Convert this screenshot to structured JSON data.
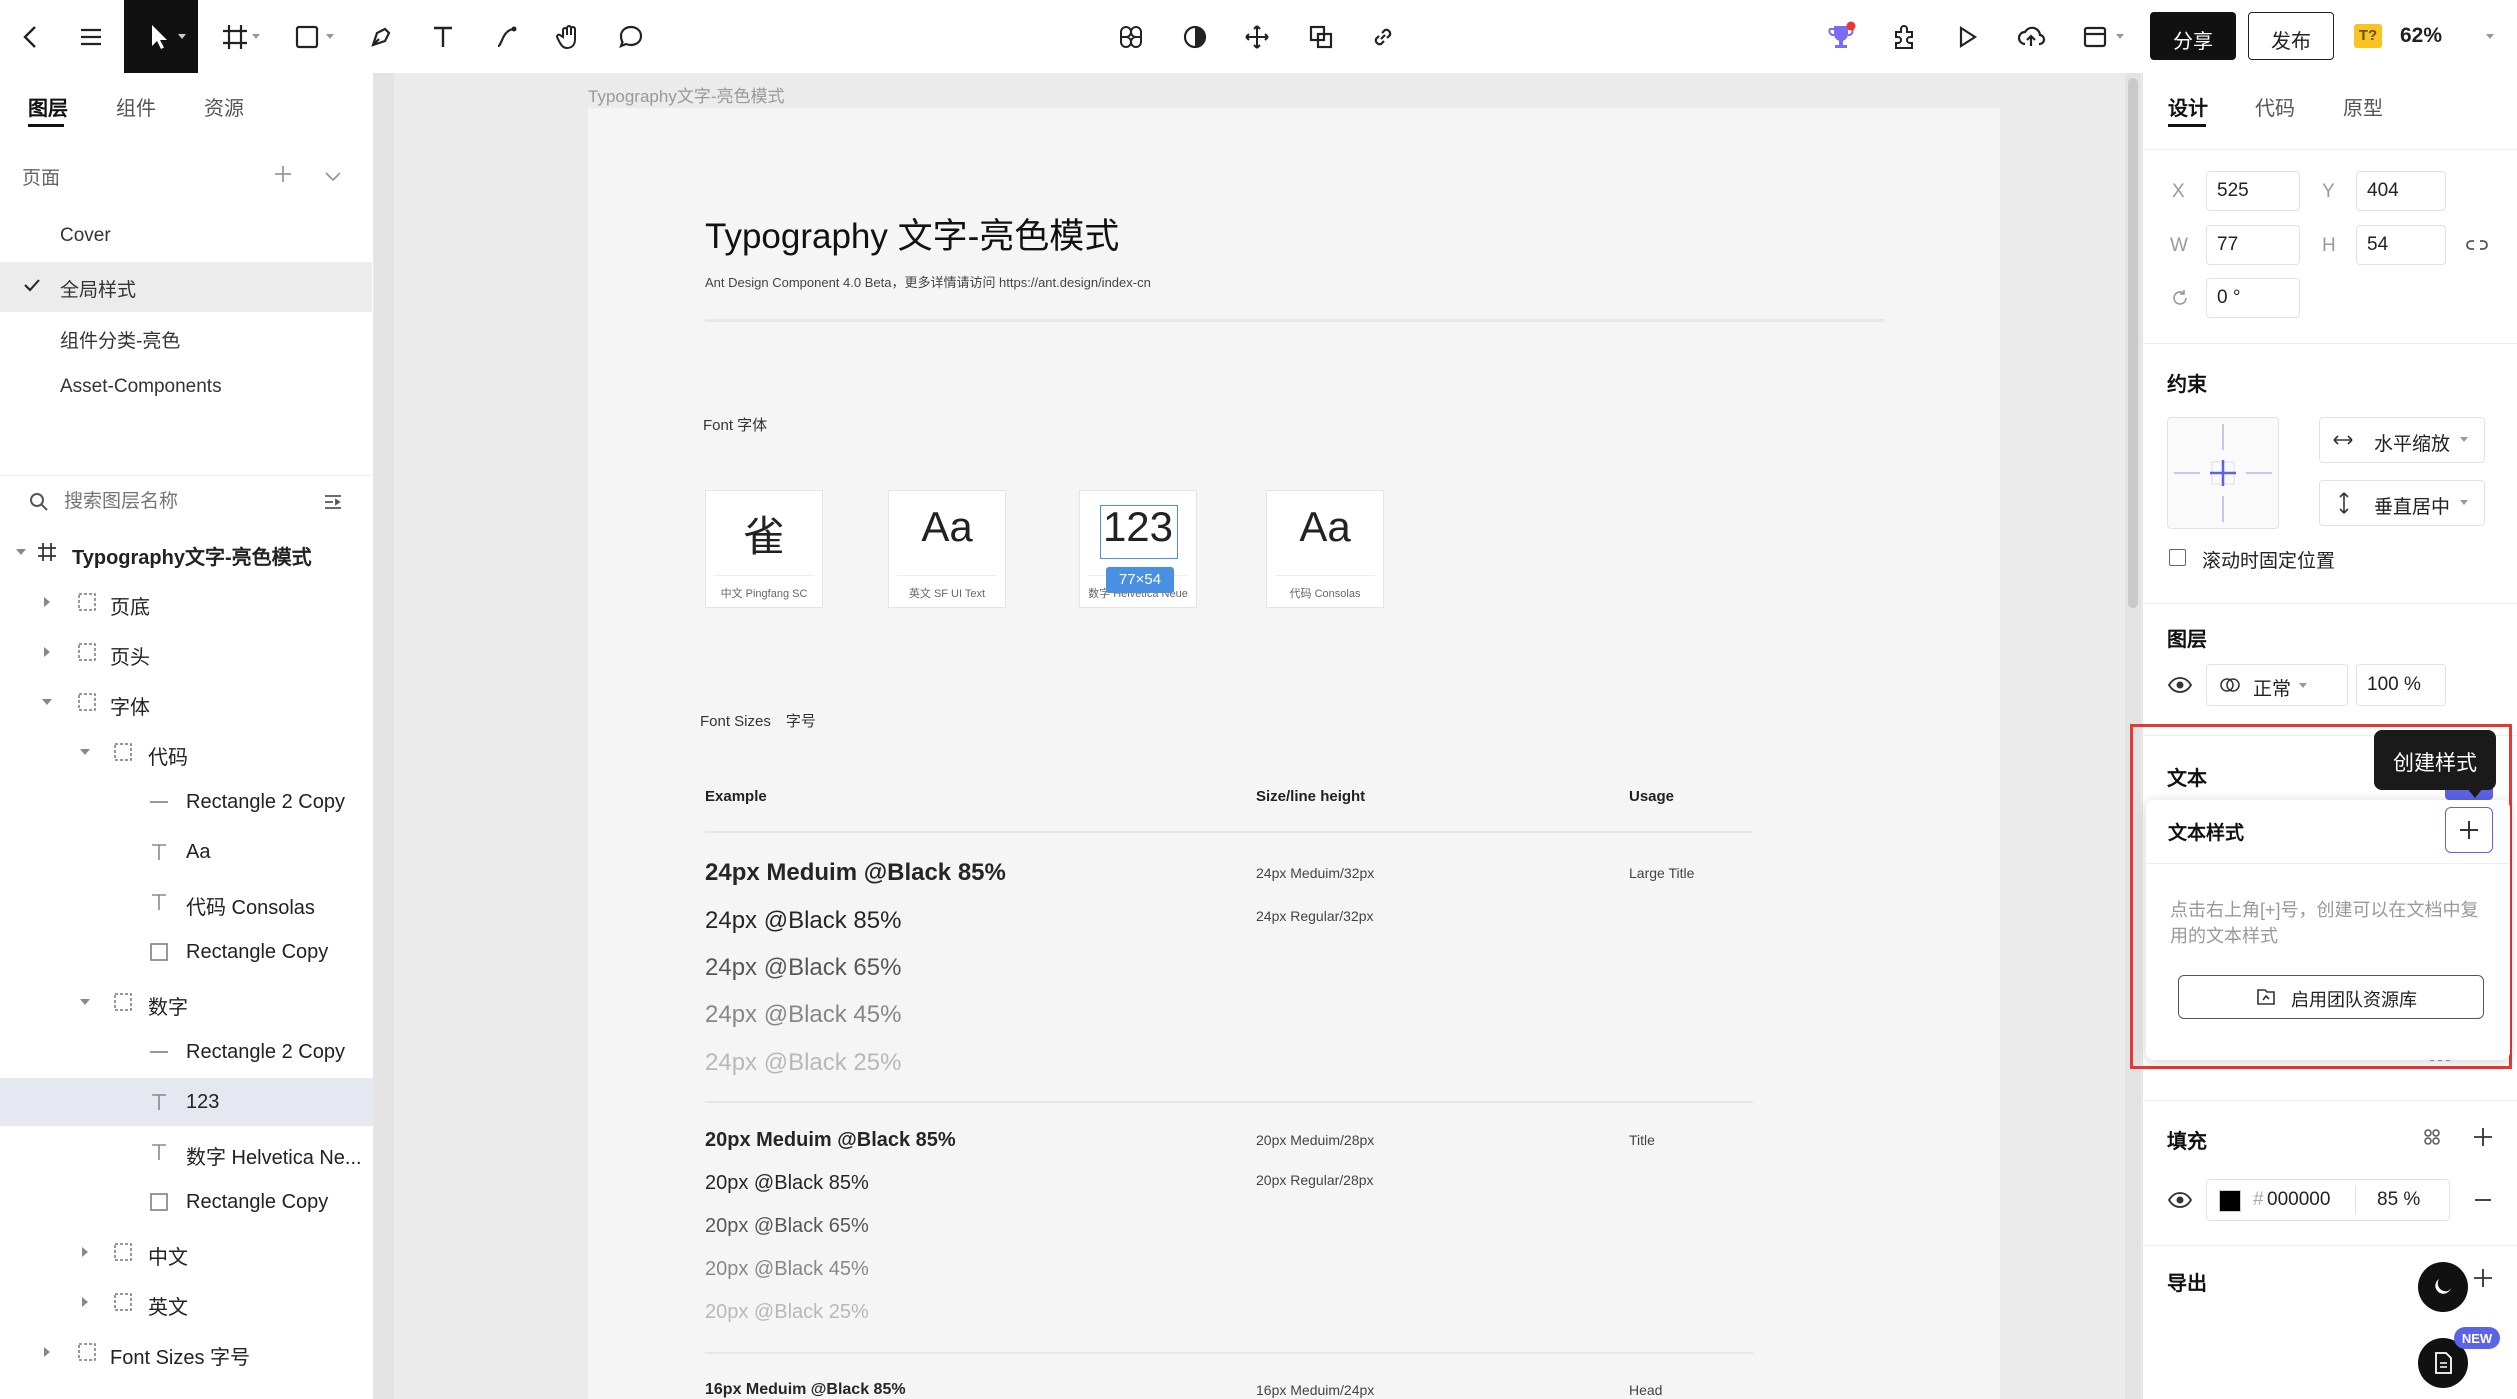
{
  "toolbar": {
    "share_label": "分享",
    "publish_label": "发布",
    "font_badge": "T?",
    "zoom": "62%"
  },
  "left_panel": {
    "tabs": [
      "图层",
      "组件",
      "资源"
    ],
    "pages_label": "页面",
    "pages": [
      "Cover",
      "全局样式",
      "组件分类-亮色",
      "Asset-Components"
    ],
    "search_placeholder": "搜索图层名称",
    "layers": [
      "Typography文字-亮色模式",
      "页底",
      "页头",
      "字体",
      "代码",
      "Rectangle 2 Copy",
      "Aa",
      "代码 Consolas",
      "Rectangle Copy",
      "数字",
      "Rectangle 2 Copy",
      "123",
      "数字 Helvetica Ne...",
      "Rectangle Copy",
      "中文",
      "英文",
      "Font Sizes 字号"
    ]
  },
  "canvas": {
    "frame_label": "Typography文字-亮色模式",
    "title": "Typography 文字-亮色模式",
    "subtitle": "Ant Design Component 4.0 Beta，更多详情请访问 https://ant.design/index-cn",
    "font_section": "Font 字体",
    "font_cards": [
      {
        "glyph": "雀",
        "caption": "中文 Pingfang SC"
      },
      {
        "glyph": "Aa",
        "caption": "英文 SF UI Text"
      },
      {
        "glyph": "123",
        "caption": "数字 Helvetica Neue"
      },
      {
        "glyph": "Aa",
        "caption": "代码 Consolas"
      }
    ],
    "selection_size": "77×54",
    "sizes_section": "Font Sizes　字号",
    "table_headers": [
      "Example",
      "Size/line height",
      "Usage"
    ],
    "group1": {
      "examples": [
        "24px Meduim @Black 85%",
        "24px @Black 85%",
        "24px @Black 65%",
        "24px @Black 45%",
        "24px @Black 25%"
      ],
      "sizes": [
        "24px Meduim/32px",
        "24px Regular/32px"
      ],
      "usage": "Large Title"
    },
    "group2": {
      "examples": [
        "20px Meduim @Black 85%",
        "20px @Black 85%",
        "20px @Black 65%",
        "20px @Black 45%",
        "20px @Black 25%"
      ],
      "sizes": [
        "20px Meduim/28px",
        "20px Regular/28px"
      ],
      "usage": "Title"
    },
    "group3": {
      "example": "16px Meduim @Black 85%",
      "size": "16px Meduim/24px",
      "usage": "Head"
    }
  },
  "right_panel": {
    "tabs": [
      "设计",
      "代码",
      "原型"
    ],
    "x_label": "X",
    "x_value": "525",
    "y_label": "Y",
    "y_value": "404",
    "w_label": "W",
    "w_value": "77",
    "h_label": "H",
    "h_value": "54",
    "rotation_value": "0 °",
    "constraints_title": "约束",
    "constraint_h": "水平缩放",
    "constraint_v": "垂直居中",
    "fix_scroll_label": "滚动时固定位置",
    "layer_title": "图层",
    "blend_mode": "正常",
    "opacity": "100 %",
    "text_title": "文本",
    "tooltip": "创建样式",
    "text_style_title": "文本样式",
    "text_style_hint": "点击右上角[+]号，创建可以在文档中复用的文本样式",
    "team_library_button": "启用团队资源库",
    "fill_title": "填充",
    "fill_hex_prefix": "#",
    "fill_hex": "000000",
    "fill_opacity": "85 %",
    "export_title": "导出",
    "new_badge": "NEW"
  },
  "colors": {
    "accent": "#1890ff",
    "highlight": "#e53935",
    "selection": "#4a90e2"
  }
}
